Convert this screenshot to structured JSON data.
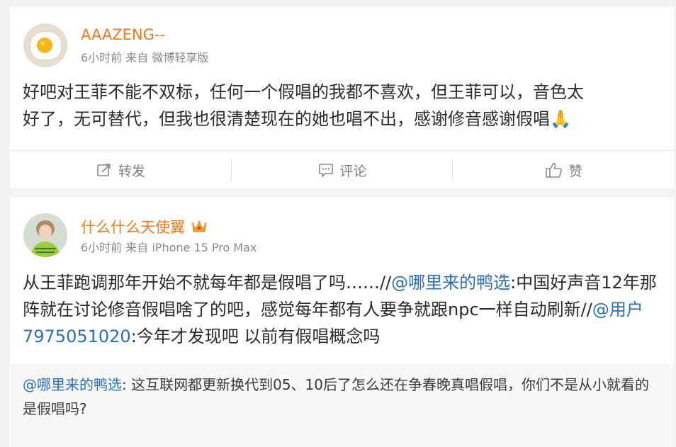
{
  "post1": {
    "username": "AAAZENG--",
    "meta": "6小时前 来自 微博轻享版",
    "content_line1": "好吧对王菲不能不双标，任何一个假唱的我都不喜欢，但王菲可以，音色太",
    "content_line2": "好了，无可替代，但我也很清楚现在的她也唱不出，感谢修音感谢假唱🙏",
    "actions": {
      "repost": "转发",
      "comment": "评论",
      "like": "赞"
    }
  },
  "post2": {
    "username": "什么什么天使翼",
    "meta": "6小时前 来自 iPhone 15 Pro Max",
    "content": {
      "part1": "从王菲跑调那年开始不就每年都是假唱了吗……//",
      "mention1": "@哪里来的鸭选",
      "part2": ":中国好声音12年那阵就在讨论修音假唱啥了的吧，感觉每年都有人要争就跟npc一样自动刷新//",
      "mention2": "@用户7975051020",
      "part3": ":今年才发现吧 以前有假唱概念吗"
    },
    "repost": {
      "mention": "@哪里来的鸭选",
      "text": ": 这互联网都更新换代到05、10后了怎么还在争春晚真唱假唱，你们不是从小就看的是假唱吗?"
    }
  },
  "colors": {
    "username": "#f27a1c",
    "mention": "#2c6fb5",
    "meta": "#8a8a8a",
    "background": "#f2f2f2"
  },
  "icons": [
    "repost-icon",
    "comment-icon",
    "like-icon",
    "crown-icon"
  ]
}
